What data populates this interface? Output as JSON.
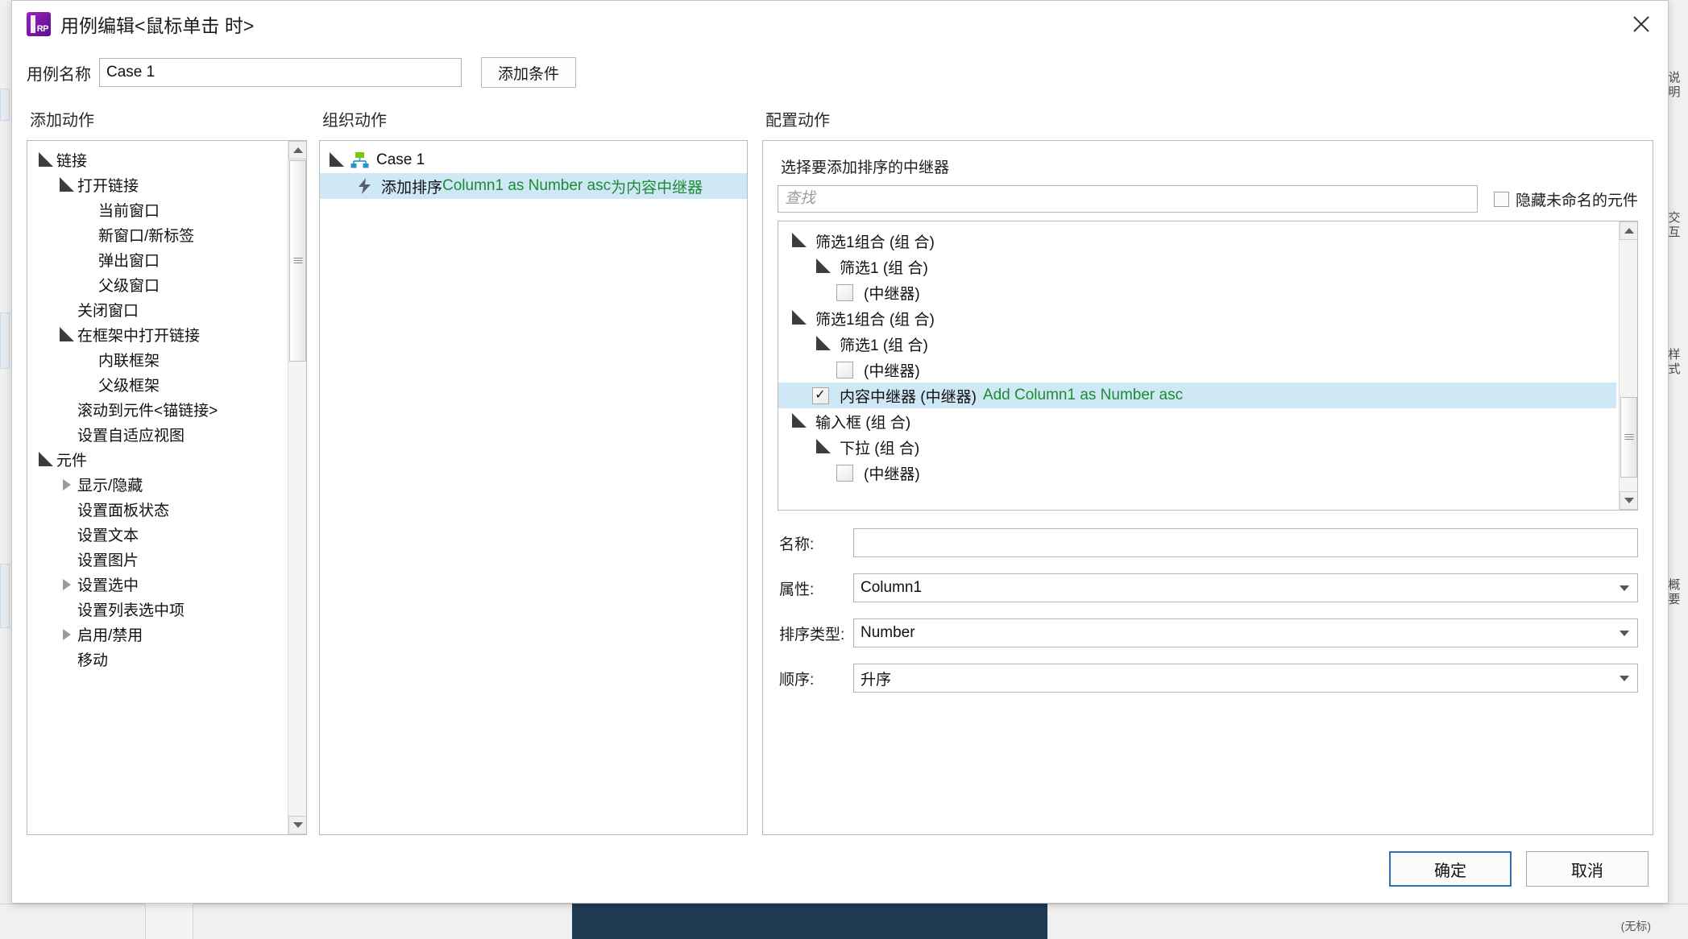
{
  "window": {
    "title": "用例编辑<鼠标单击 时>",
    "app_icon": "axure-rp-icon",
    "close_icon": "close-icon"
  },
  "case_name": {
    "label": "用例名称",
    "value": "Case 1",
    "add_condition_button": "添加条件"
  },
  "columns": {
    "add_action": "添加动作",
    "organize_action": "组织动作",
    "configure_action": "配置动作"
  },
  "action_tree": [
    {
      "label": "链接",
      "depth": 0,
      "state": "open"
    },
    {
      "label": "打开链接",
      "depth": 1,
      "state": "open"
    },
    {
      "label": "当前窗口",
      "depth": 2,
      "state": "leaf"
    },
    {
      "label": "新窗口/新标签",
      "depth": 2,
      "state": "leaf"
    },
    {
      "label": "弹出窗口",
      "depth": 2,
      "state": "leaf"
    },
    {
      "label": "父级窗口",
      "depth": 2,
      "state": "leaf"
    },
    {
      "label": "关闭窗口",
      "depth": 1,
      "state": "leaf"
    },
    {
      "label": "在框架中打开链接",
      "depth": 1,
      "state": "open"
    },
    {
      "label": "内联框架",
      "depth": 2,
      "state": "leaf"
    },
    {
      "label": "父级框架",
      "depth": 2,
      "state": "leaf"
    },
    {
      "label": "滚动到元件<锚链接>",
      "depth": 1,
      "state": "leaf"
    },
    {
      "label": "设置自适应视图",
      "depth": 1,
      "state": "leaf"
    },
    {
      "label": "元件",
      "depth": 0,
      "state": "open"
    },
    {
      "label": "显示/隐藏",
      "depth": 1,
      "state": "closed"
    },
    {
      "label": "设置面板状态",
      "depth": 1,
      "state": "leaf"
    },
    {
      "label": "设置文本",
      "depth": 1,
      "state": "leaf"
    },
    {
      "label": "设置图片",
      "depth": 1,
      "state": "leaf"
    },
    {
      "label": "设置选中",
      "depth": 1,
      "state": "closed"
    },
    {
      "label": "设置列表选中项",
      "depth": 1,
      "state": "leaf"
    },
    {
      "label": "启用/禁用",
      "depth": 1,
      "state": "closed"
    },
    {
      "label": "移动",
      "depth": 1,
      "state": "leaf"
    }
  ],
  "organize_tree": {
    "case_node": {
      "label": "Case 1",
      "icon": "sitemap-icon",
      "state": "open"
    },
    "action_node": {
      "icon": "bolt-icon",
      "prefix": "添加排序 ",
      "param": "Column1 as Number asc",
      "middle": " 为 ",
      "target": "内容中继器",
      "selected": true
    }
  },
  "configure": {
    "section_label": "选择要添加排序的中继器",
    "find_placeholder": "查找",
    "find_value": "",
    "hide_unnamed_label": "隐藏未命名的元件",
    "hide_unnamed_checked": false,
    "repeater_tree": [
      {
        "label": "筛选1组合 (组 合)",
        "depth": 0,
        "type": "group",
        "state": "open"
      },
      {
        "label": "筛选1 (组 合)",
        "depth": 1,
        "type": "group",
        "state": "open"
      },
      {
        "label": "(中继器)",
        "depth": 2,
        "type": "checkbox",
        "checked": false
      },
      {
        "label": "筛选1组合 (组 合)",
        "depth": 0,
        "type": "group",
        "state": "open"
      },
      {
        "label": "筛选1 (组 合)",
        "depth": 1,
        "type": "group",
        "state": "open"
      },
      {
        "label": "(中继器)",
        "depth": 2,
        "type": "checkbox",
        "checked": false
      },
      {
        "label": "内容中继器 (中继器)",
        "suffix": "Add Column1 as Number asc",
        "depth": 1,
        "type": "checkbox",
        "checked": true,
        "selected": true
      },
      {
        "label": "输入框 (组 合)",
        "depth": 0,
        "type": "group",
        "state": "open"
      },
      {
        "label": "下拉 (组 合)",
        "depth": 1,
        "type": "group",
        "state": "open"
      },
      {
        "label": "(中继器)",
        "depth": 2,
        "type": "checkbox",
        "checked": false
      }
    ],
    "fields": [
      {
        "label": "名称:",
        "value": "",
        "kind": "text"
      },
      {
        "label": "属性:",
        "value": "Column1",
        "kind": "select"
      },
      {
        "label": "排序类型:",
        "value": "Number",
        "kind": "select"
      },
      {
        "label": "顺序:",
        "value": "升序",
        "kind": "select"
      }
    ]
  },
  "footer": {
    "ok": "确定",
    "cancel": "取消"
  },
  "background": {
    "right_rail": [
      "说",
      "明",
      "交",
      "互",
      "样",
      "式",
      "概",
      "要"
    ],
    "status_text": "(无标)"
  },
  "colors": {
    "selection": "#cfe8f5",
    "param_green": "#1e8a35",
    "brand_purple": "#8a1fb0",
    "primary_border": "#2f6fb5"
  }
}
